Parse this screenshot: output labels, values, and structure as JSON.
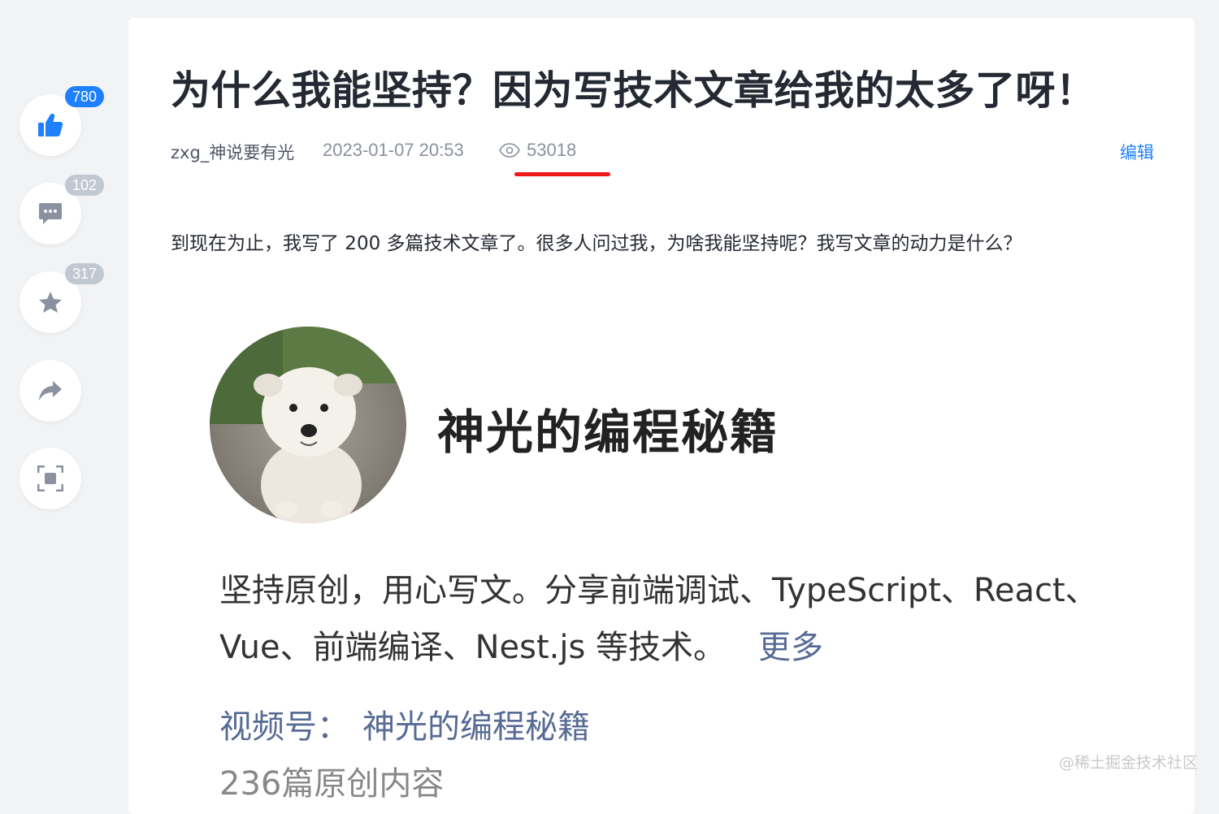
{
  "sidebar": {
    "like_count": "780",
    "comment_count": "102",
    "collect_count": "317",
    "accent_color": "#1e80ff"
  },
  "article": {
    "title": "为什么我能坚持？因为写技术文章给我的太多了呀！",
    "author": "zxg_神说要有光",
    "date": "2023-01-07 20:53",
    "views": "53018",
    "edit_label": "编辑",
    "intro": "到现在为止，我写了 200 多篇技术文章了。很多人问过我，为啥我能坚持呢？我写文章的动力是什么？"
  },
  "embed": {
    "profile_name": "神光的编程秘籍",
    "description": "坚持原创，用心写文。分享前端调试、TypeScript、React、Vue、前端编译、Nest.js 等技术。",
    "more_label": "更多",
    "channel_label": "视频号：",
    "channel_name": "神光的编程秘籍",
    "article_count": "236篇原创内容"
  },
  "watermark": "@稀土掘金技术社区"
}
